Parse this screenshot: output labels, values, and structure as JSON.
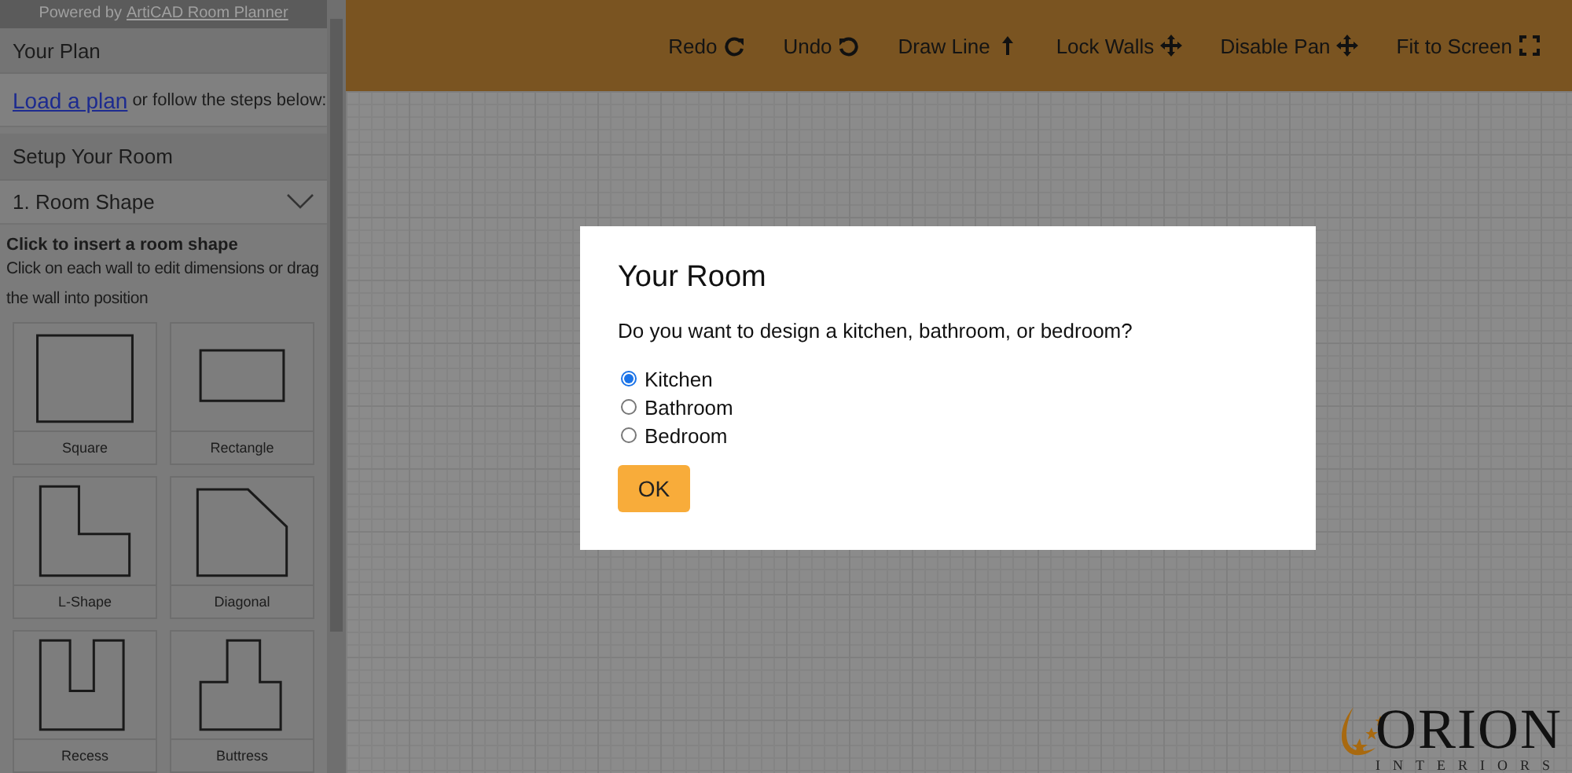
{
  "sidebar": {
    "powered_by": {
      "prefix": "Powered by",
      "link": "ArtiCAD Room Planner"
    },
    "your_plan": "Your Plan",
    "load_link": "Load a plan",
    "load_text": "or follow the steps below:",
    "setup_heading": "Setup Your Room",
    "step_label": "1. Room Shape",
    "instructions_title": "Click to insert a room shape",
    "instructions": "Click on each wall to edit dimensions or drag the wall into position",
    "shapes": [
      {
        "kind": "square",
        "label": "Square"
      },
      {
        "kind": "rectangle",
        "label": "Rectangle"
      },
      {
        "kind": "l-shape",
        "label": "L-Shape"
      },
      {
        "kind": "diagonal",
        "label": "Diagonal"
      },
      {
        "kind": "recess",
        "label": "Recess"
      },
      {
        "kind": "buttress",
        "label": "Buttress"
      }
    ]
  },
  "toolbar": [
    {
      "label": "Redo",
      "kind": "redo"
    },
    {
      "label": "Undo",
      "kind": "undo"
    },
    {
      "label": "Draw Line",
      "kind": "arrow-up"
    },
    {
      "label": "Lock Walls",
      "kind": "move"
    },
    {
      "label": "Disable Pan",
      "kind": "move"
    },
    {
      "label": "Fit to Screen",
      "kind": "expand"
    }
  ],
  "modal": {
    "title": "Your Room",
    "question": "Do you want to design a kitchen, bathroom, or bedroom?",
    "options": [
      {
        "label": "Kitchen",
        "selected": true
      },
      {
        "label": "Bathroom",
        "selected": false
      },
      {
        "label": "Bedroom",
        "selected": false
      }
    ],
    "button": "OK"
  },
  "logo": {
    "name": "ORION",
    "tagline": "INTERIORS"
  }
}
